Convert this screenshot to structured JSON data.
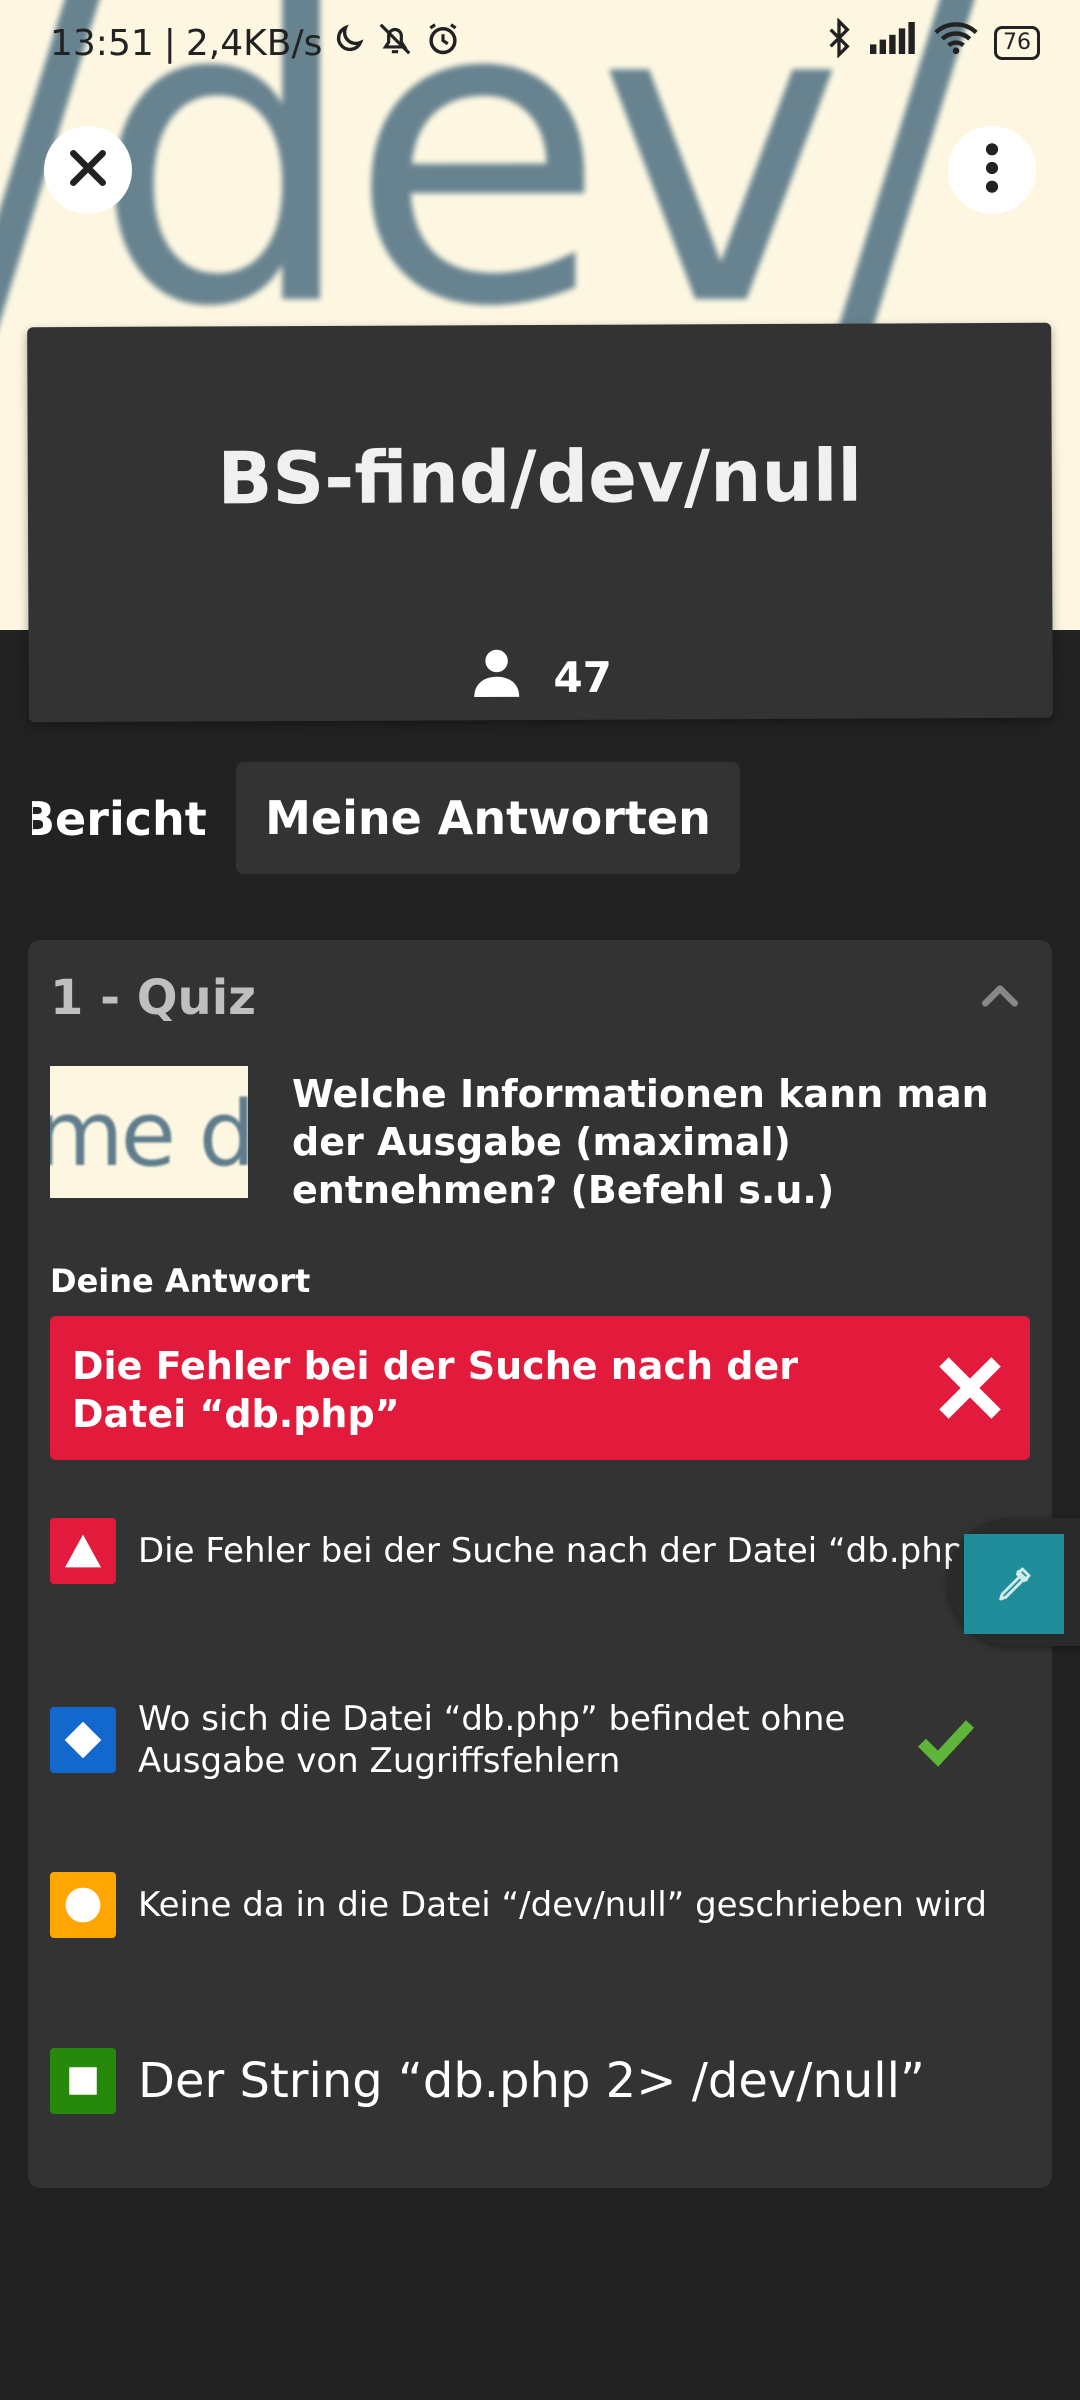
{
  "status_bar": {
    "time": "13:51",
    "separator": "|",
    "speed": "2,4KB/s",
    "battery": "76",
    "icons": [
      "moon-icon",
      "bell-off-icon",
      "alarm-icon",
      "bluetooth-icon",
      "signal-icon",
      "wifi-icon",
      "battery-icon"
    ]
  },
  "hero": {
    "background_word": "/dev/"
  },
  "header": {
    "close_icon": "close-icon",
    "menu_icon": "more-vertical-icon",
    "title": "BS-find/dev/null",
    "player_count": "47"
  },
  "tabs": {
    "report": "Bericht",
    "my_answers": "Meine Antworten"
  },
  "quiz": {
    "header": "1 - Quiz",
    "thumbnail_text": "me d",
    "question": "Welche Informationen kann man der Ausgabe (maximal) entnehmen? (Befehl s.u.)",
    "your_answer_label": "Deine Antwort",
    "your_answer": "Die Fehler bei der Suche nach der Datei “db.php”",
    "options": [
      {
        "shape": "triangle",
        "color": "#e21b3c",
        "text": "Die Fehler bei der Suche nach der Datei “db.php”",
        "correct": false
      },
      {
        "shape": "diamond",
        "color": "#1368ce",
        "text": "Wo sich die Datei “db.php” befindet ohne Ausgabe von Zugriffsfehlern",
        "correct": true
      },
      {
        "shape": "circle",
        "color": "#ffa602",
        "text": "Keine da in die Datei “/dev/null” geschrieben wird",
        "correct": false
      },
      {
        "shape": "square",
        "color": "#26890c",
        "text": "Der String “db.php 2> /dev/null”",
        "correct": false
      }
    ]
  },
  "colors": {
    "accent_red": "#e21b3c",
    "correct_green": "#5fb43a",
    "card": "#333333",
    "background": "#222222",
    "hero": "#fdf7e2"
  }
}
